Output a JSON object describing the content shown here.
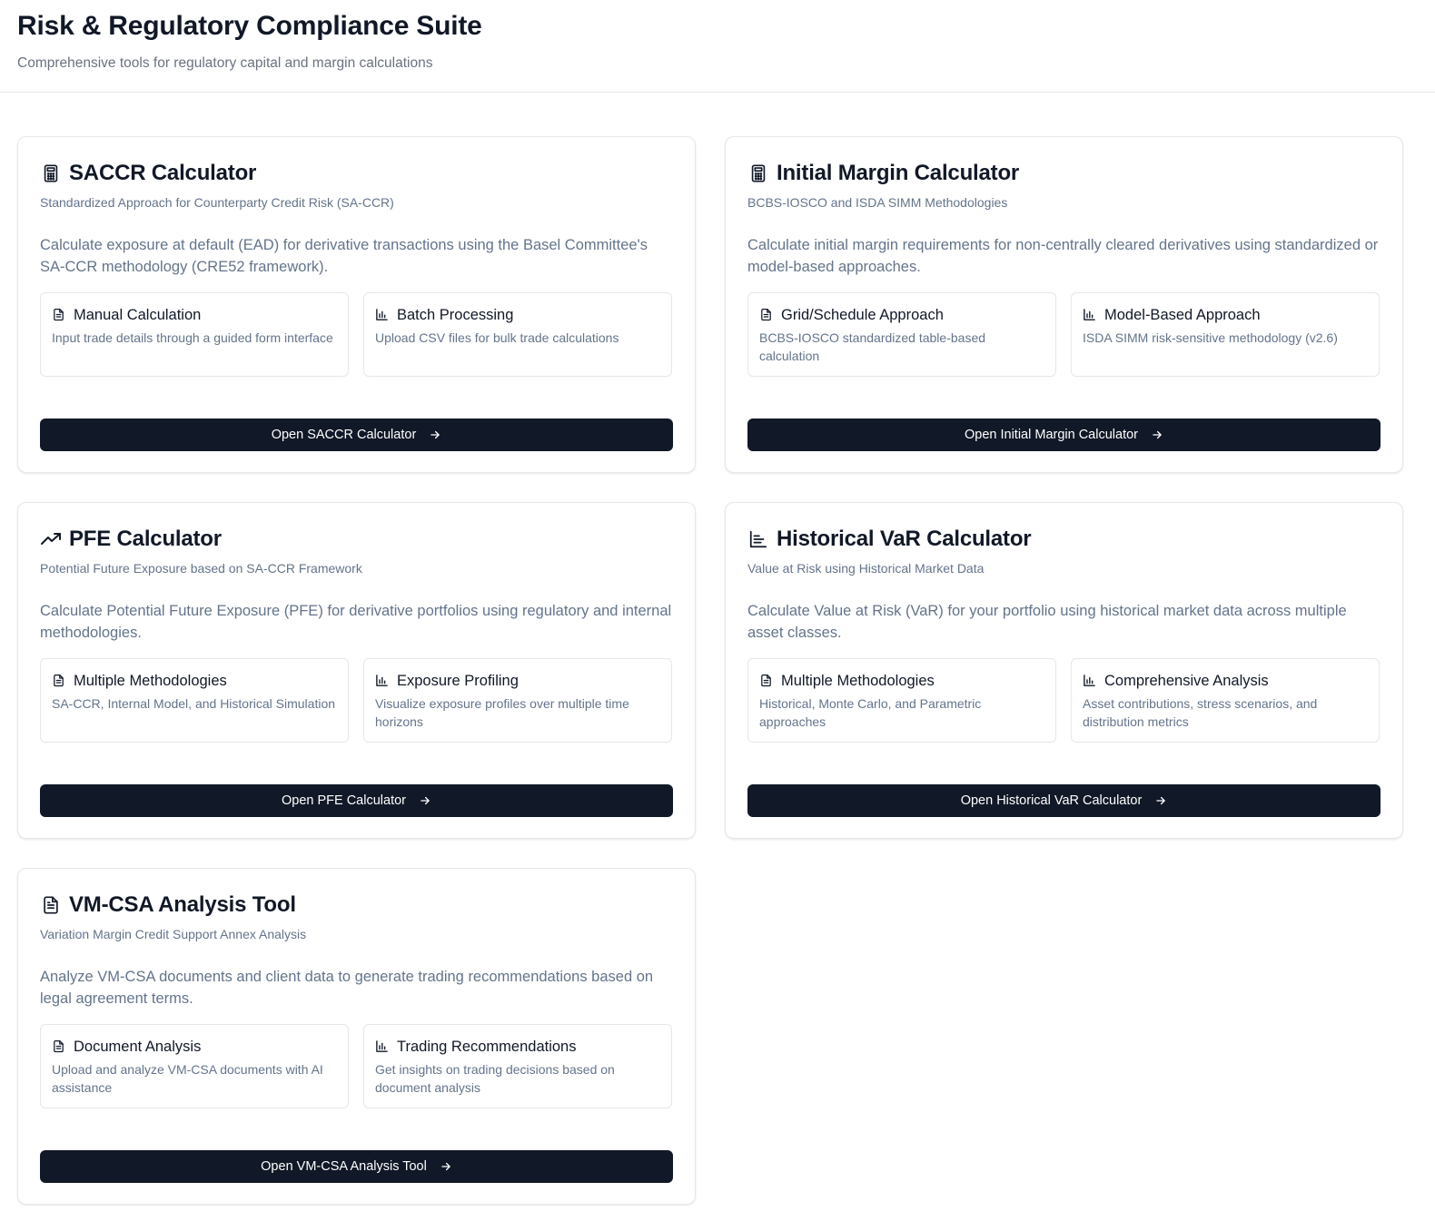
{
  "header": {
    "title": "Risk & Regulatory Compliance Suite",
    "subtitle": "Comprehensive tools for regulatory capital and margin calculations"
  },
  "cards": [
    {
      "icon": "calculator-icon",
      "title": "SACCR Calculator",
      "subtitle": "Standardized Approach for Counterparty Credit Risk (SA-CCR)",
      "description": "Calculate exposure at default (EAD) for derivative transactions using the Basel Committee's SA-CCR methodology (CRE52 framework).",
      "features": [
        {
          "icon": "document-icon",
          "title": "Manual Calculation",
          "description": "Input trade details through a guided form interface"
        },
        {
          "icon": "bar-chart-icon",
          "title": "Batch Processing",
          "description": "Upload CSV files for bulk trade calculations"
        }
      ],
      "button": "Open SACCR Calculator"
    },
    {
      "icon": "calculator-icon",
      "title": "Initial Margin Calculator",
      "subtitle": "BCBS-IOSCO and ISDA SIMM Methodologies",
      "description": "Calculate initial margin requirements for non-centrally cleared derivatives using standardized or model-based approaches.",
      "features": [
        {
          "icon": "document-icon",
          "title": "Grid/Schedule Approach",
          "description": "BCBS-IOSCO standardized table-based calculation"
        },
        {
          "icon": "bar-chart-icon",
          "title": "Model-Based Approach",
          "description": "ISDA SIMM risk-sensitive methodology (v2.6)"
        }
      ],
      "button": "Open Initial Margin Calculator"
    },
    {
      "icon": "trending-up-icon",
      "title": "PFE Calculator",
      "subtitle": "Potential Future Exposure based on SA-CCR Framework",
      "description": "Calculate Potential Future Exposure (PFE) for derivative portfolios using regulatory and internal methodologies.",
      "features": [
        {
          "icon": "document-icon",
          "title": "Multiple Methodologies",
          "description": "SA-CCR, Internal Model, and Historical Simulation"
        },
        {
          "icon": "bar-chart-icon",
          "title": "Exposure Profiling",
          "description": "Visualize exposure profiles over multiple time horizons"
        }
      ],
      "button": "Open PFE Calculator"
    },
    {
      "icon": "chart-bars-horizontal-icon",
      "title": "Historical VaR Calculator",
      "subtitle": "Value at Risk using Historical Market Data",
      "description": "Calculate Value at Risk (VaR) for your portfolio using historical market data across multiple asset classes.",
      "features": [
        {
          "icon": "document-icon",
          "title": "Multiple Methodologies",
          "description": "Historical, Monte Carlo, and Parametric approaches"
        },
        {
          "icon": "bar-chart-icon",
          "title": "Comprehensive Analysis",
          "description": "Asset contributions, stress scenarios, and distribution metrics"
        }
      ],
      "button": "Open Historical VaR Calculator"
    },
    {
      "icon": "file-text-icon",
      "title": "VM-CSA Analysis Tool",
      "subtitle": "Variation Margin Credit Support Annex Analysis",
      "description": "Analyze VM-CSA documents and client data to generate trading recommendations based on legal agreement terms.",
      "features": [
        {
          "icon": "document-icon",
          "title": "Document Analysis",
          "description": "Upload and analyze VM-CSA documents with AI assistance"
        },
        {
          "icon": "bar-chart-icon",
          "title": "Trading Recommendations",
          "description": "Get insights on trading decisions based on document analysis"
        }
      ],
      "button": "Open VM-CSA Analysis Tool"
    }
  ]
}
